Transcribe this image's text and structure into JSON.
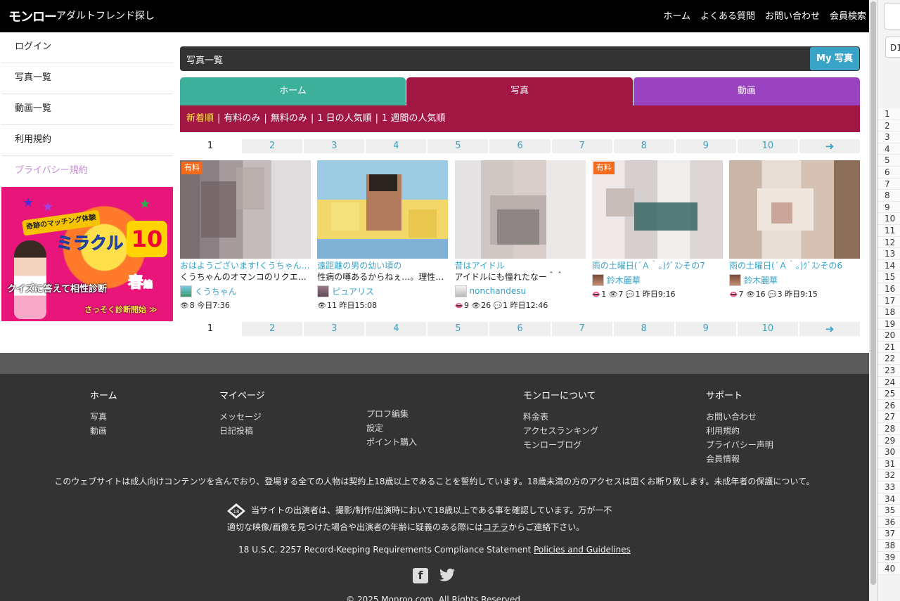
{
  "header": {
    "logo": "モンロー",
    "tagline": "アダルトフレンド探し",
    "nav": [
      "ホーム",
      "よくある質問",
      "お問い合わせ",
      "会員検索"
    ]
  },
  "sidebar": {
    "items": [
      "ログイン",
      "写真一覧",
      "動画一覧",
      "利用規約",
      "プライバシー規約"
    ],
    "banner": {
      "line1": "奇跡のマッチング体験",
      "line2": "ミラクル",
      "num": "10",
      "line3": "クイズに答えて相性診断",
      "season": "春",
      "season_suffix": "編",
      "cta": "さっそく診断開始"
    }
  },
  "main": {
    "title": "写真一覧",
    "my_button": "My 写真",
    "tabs": [
      "ホーム",
      "写真",
      "動画"
    ],
    "filters": [
      "新着順",
      "有料のみ",
      "無料のみ",
      "1 日の人気順",
      "1 週間の人気順"
    ],
    "pages": [
      "1",
      "2",
      "3",
      "4",
      "5",
      "6",
      "7",
      "8",
      "9",
      "10"
    ],
    "cards": [
      {
        "badge": "有料",
        "title": "おはようございます!くうちゃんの…",
        "desc": "くうちゃんのオマンコのリクエ…",
        "user": "くうちゃん",
        "likes": "",
        "views": "8",
        "comments": "",
        "time": "今日7:36"
      },
      {
        "badge": "",
        "title": "遠距離の男の幼い頃の",
        "desc": "性病の噂あるからねぇ…。理性…",
        "user": "ピュアリス",
        "likes": "",
        "views": "11",
        "comments": "",
        "time": "昨日15:08"
      },
      {
        "badge": "",
        "title": "昔はアイドル",
        "desc": "アイドルにも憧れたなー＾＾",
        "user": "nonchandesu",
        "likes": "9",
        "views": "26",
        "comments": "1",
        "time": "昨日12:46"
      },
      {
        "badge": "有料",
        "title": "雨の土曜日(´Ａ｀。)ｸﾞｽﾝその7",
        "desc": "",
        "user": "鈴木麗華",
        "likes": "1",
        "views": "7",
        "comments": "1",
        "time": "昨日9:16"
      },
      {
        "badge": "",
        "title": "雨の土曜日(´Ａ｀。)ｸﾞｽﾝその6",
        "desc": "",
        "user": "鈴木麗華",
        "likes": "7",
        "views": "16",
        "comments": "3",
        "time": "昨日9:15"
      }
    ]
  },
  "footer": {
    "col_home": {
      "heading": "ホーム",
      "links": [
        "写真",
        "動画"
      ]
    },
    "col_mypage": {
      "heading": "マイページ",
      "links": [
        "メッセージ",
        "日記投稿"
      ]
    },
    "col_mypage2": {
      "links": [
        "プロフ編集",
        "設定",
        "ポイント購入"
      ]
    },
    "col_about": {
      "heading": "モンローについて",
      "links": [
        "料金表",
        "アクセスランキング",
        "モンローブログ"
      ]
    },
    "col_support": {
      "heading": "サポート",
      "links": [
        "お問い合わせ",
        "利用規約",
        "プライバシー声明",
        "会員情報"
      ]
    },
    "notice": "このウェブサイトは成人向けコンテンツを含んでおり、登場する全ての人物は契約上18歳以上であることを誓約しています。18歳未満の方のアクセスは固くお断り致します。未成年者の保護について。",
    "notice2_line1": "当サイトの出演者は、撮影/制作/出演時において18歳以上である事を確認しています。万が一不",
    "notice2_line2_pre": "適切な映像/画像を見つけた場合や出演者の年齢に疑義のある際には",
    "notice2_link": "コチラ",
    "notice2_line2_post": "からご連絡下さい。",
    "law_text": "18 U.S.C. 2257 Record-Keeping Requirements Compliance Statement",
    "law_link": "Policies and Guidelines",
    "copyright": "© 2025 Monroo.com. All Rights Reserved."
  },
  "sidepane": {
    "label": "D1",
    "rows": [
      "1",
      "2",
      "3",
      "4",
      "5",
      "6",
      "7",
      "8",
      "9",
      "10",
      "11",
      "12",
      "13",
      "14",
      "15",
      "16",
      "17",
      "18",
      "19",
      "20",
      "21",
      "22",
      "23",
      "24",
      "25",
      "26",
      "27",
      "28",
      "29",
      "30",
      "31",
      "32",
      "33",
      "34",
      "35",
      "36",
      "37",
      "38",
      "39",
      "40"
    ]
  },
  "colors": {
    "header_bg": "#000000",
    "tab_home": "#3db09b",
    "tab_photo": "#a11744",
    "tab_video": "#9a43c0",
    "accent": "#3aa3c8",
    "badge": "#f26b1d",
    "filter_selected": "#ffe04a",
    "footer_bg": "#333333"
  }
}
